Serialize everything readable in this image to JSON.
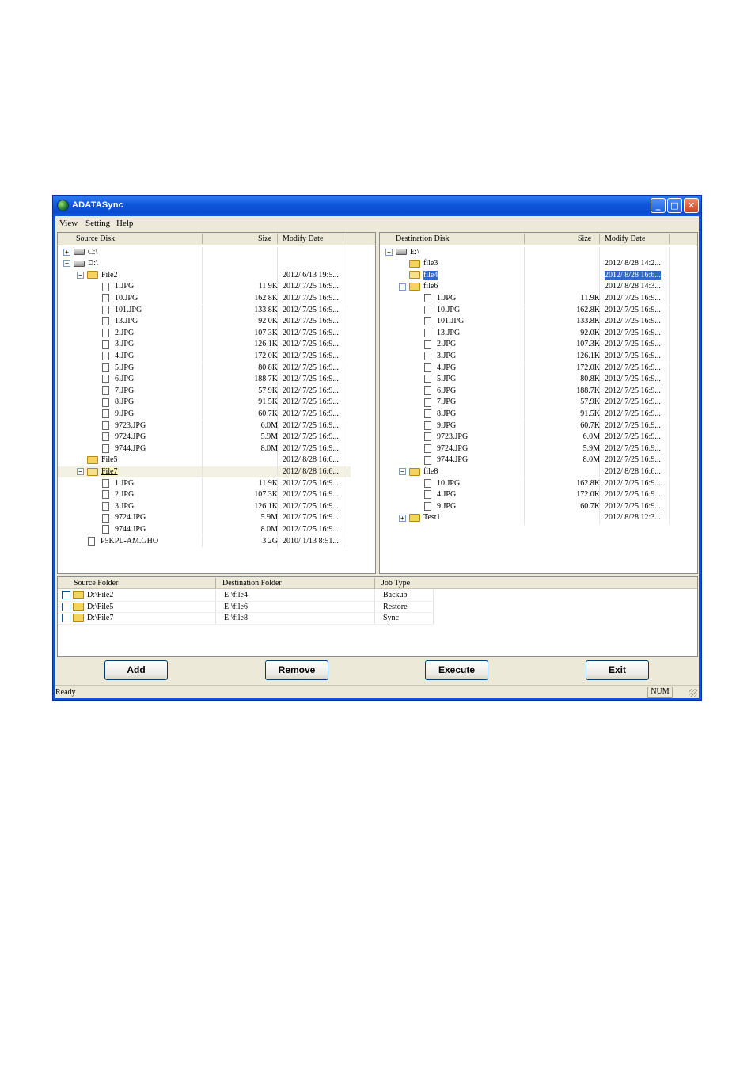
{
  "window": {
    "title": "ADATASync",
    "icons": {
      "app": "globe-sync-icon",
      "minimize": "minimize-icon",
      "maximize": "maximize-icon",
      "close": "close-icon"
    }
  },
  "menu": {
    "items": [
      "View",
      "Setting",
      "Help"
    ]
  },
  "source": {
    "headers": {
      "name": "Source Disk",
      "size": "Size",
      "date": "Modify Date"
    },
    "rows": [
      {
        "level": 0,
        "type": "drive",
        "expander": "+",
        "name": "C:\\",
        "size": "",
        "date": ""
      },
      {
        "level": 0,
        "type": "drive",
        "expander": "-",
        "name": "D:\\",
        "size": "",
        "date": ""
      },
      {
        "level": 1,
        "type": "folder",
        "expander": "-",
        "name": "File2",
        "size": "",
        "date": "2012/ 6/13 19:5..."
      },
      {
        "level": 2,
        "type": "file",
        "name": "1.JPG",
        "size": "11.9K",
        "date": "2012/ 7/25 16:9..."
      },
      {
        "level": 2,
        "type": "file",
        "name": "10.JPG",
        "size": "162.8K",
        "date": "2012/ 7/25 16:9..."
      },
      {
        "level": 2,
        "type": "file",
        "name": "101.JPG",
        "size": "133.8K",
        "date": "2012/ 7/25 16:9..."
      },
      {
        "level": 2,
        "type": "file",
        "name": "13.JPG",
        "size": "92.0K",
        "date": "2012/ 7/25 16:9..."
      },
      {
        "level": 2,
        "type": "file",
        "name": "2.JPG",
        "size": "107.3K",
        "date": "2012/ 7/25 16:9..."
      },
      {
        "level": 2,
        "type": "file",
        "name": "3.JPG",
        "size": "126.1K",
        "date": "2012/ 7/25 16:9..."
      },
      {
        "level": 2,
        "type": "file",
        "name": "4.JPG",
        "size": "172.0K",
        "date": "2012/ 7/25 16:9..."
      },
      {
        "level": 2,
        "type": "file",
        "name": "5.JPG",
        "size": "80.8K",
        "date": "2012/ 7/25 16:9..."
      },
      {
        "level": 2,
        "type": "file",
        "name": "6.JPG",
        "size": "188.7K",
        "date": "2012/ 7/25 16:9..."
      },
      {
        "level": 2,
        "type": "file",
        "name": "7.JPG",
        "size": "57.9K",
        "date": "2012/ 7/25 16:9..."
      },
      {
        "level": 2,
        "type": "file",
        "name": "8.JPG",
        "size": "91.5K",
        "date": "2012/ 7/25 16:9..."
      },
      {
        "level": 2,
        "type": "file",
        "name": "9.JPG",
        "size": "60.7K",
        "date": "2012/ 7/25 16:9..."
      },
      {
        "level": 2,
        "type": "file",
        "name": "9723.JPG",
        "size": "6.0M",
        "date": "2012/ 7/25 16:9..."
      },
      {
        "level": 2,
        "type": "file",
        "name": "9724.JPG",
        "size": "5.9M",
        "date": "2012/ 7/25 16:9..."
      },
      {
        "level": 2,
        "type": "file",
        "name": "9744.JPG",
        "size": "8.0M",
        "date": "2012/ 7/25 16:9..."
      },
      {
        "level": 1,
        "type": "folder",
        "expander": "",
        "name": "File5",
        "size": "",
        "date": "2012/ 8/28 16:6..."
      },
      {
        "level": 1,
        "type": "folder-open",
        "expander": "-",
        "name": "File7",
        "size": "",
        "date": "2012/ 8/28 16:6...",
        "selected": "soft"
      },
      {
        "level": 2,
        "type": "file",
        "name": "1.JPG",
        "size": "11.9K",
        "date": "2012/ 7/25 16:9..."
      },
      {
        "level": 2,
        "type": "file",
        "name": "2.JPG",
        "size": "107.3K",
        "date": "2012/ 7/25 16:9..."
      },
      {
        "level": 2,
        "type": "file",
        "name": "3.JPG",
        "size": "126.1K",
        "date": "2012/ 7/25 16:9..."
      },
      {
        "level": 2,
        "type": "file",
        "name": "9724.JPG",
        "size": "5.9M",
        "date": "2012/ 7/25 16:9..."
      },
      {
        "level": 2,
        "type": "file",
        "name": "9744.JPG",
        "size": "8.0M",
        "date": "2012/ 7/25 16:9..."
      },
      {
        "level": 1,
        "type": "file",
        "name": "P5KPL-AM.GHO",
        "size": "3.2G",
        "date": "2010/ 1/13 8:51..."
      }
    ]
  },
  "destination": {
    "headers": {
      "name": "Destination Disk",
      "size": "Size",
      "date": "Modify Date"
    },
    "rows": [
      {
        "level": 0,
        "type": "drive",
        "expander": "-",
        "name": "E:\\",
        "size": "",
        "date": ""
      },
      {
        "level": 1,
        "type": "folder",
        "expander": "",
        "name": "file3",
        "size": "",
        "date": "2012/ 8/28 14:2..."
      },
      {
        "level": 1,
        "type": "folder-open",
        "expander": "",
        "name": "file4",
        "size": "",
        "date": "2012/ 8/28 16:6...",
        "selected": "blue"
      },
      {
        "level": 1,
        "type": "folder",
        "expander": "-",
        "name": "file6",
        "size": "",
        "date": "2012/ 8/28 14:3..."
      },
      {
        "level": 2,
        "type": "file",
        "name": "1.JPG",
        "size": "11.9K",
        "date": "2012/ 7/25 16:9..."
      },
      {
        "level": 2,
        "type": "file",
        "name": "10.JPG",
        "size": "162.8K",
        "date": "2012/ 7/25 16:9..."
      },
      {
        "level": 2,
        "type": "file",
        "name": "101.JPG",
        "size": "133.8K",
        "date": "2012/ 7/25 16:9..."
      },
      {
        "level": 2,
        "type": "file",
        "name": "13.JPG",
        "size": "92.0K",
        "date": "2012/ 7/25 16:9..."
      },
      {
        "level": 2,
        "type": "file",
        "name": "2.JPG",
        "size": "107.3K",
        "date": "2012/ 7/25 16:9..."
      },
      {
        "level": 2,
        "type": "file",
        "name": "3.JPG",
        "size": "126.1K",
        "date": "2012/ 7/25 16:9..."
      },
      {
        "level": 2,
        "type": "file",
        "name": "4.JPG",
        "size": "172.0K",
        "date": "2012/ 7/25 16:9..."
      },
      {
        "level": 2,
        "type": "file",
        "name": "5.JPG",
        "size": "80.8K",
        "date": "2012/ 7/25 16:9..."
      },
      {
        "level": 2,
        "type": "file",
        "name": "6.JPG",
        "size": "188.7K",
        "date": "2012/ 7/25 16:9..."
      },
      {
        "level": 2,
        "type": "file",
        "name": "7.JPG",
        "size": "57.9K",
        "date": "2012/ 7/25 16:9..."
      },
      {
        "level": 2,
        "type": "file",
        "name": "8.JPG",
        "size": "91.5K",
        "date": "2012/ 7/25 16:9..."
      },
      {
        "level": 2,
        "type": "file",
        "name": "9.JPG",
        "size": "60.7K",
        "date": "2012/ 7/25 16:9..."
      },
      {
        "level": 2,
        "type": "file",
        "name": "9723.JPG",
        "size": "6.0M",
        "date": "2012/ 7/25 16:9..."
      },
      {
        "level": 2,
        "type": "file",
        "name": "9724.JPG",
        "size": "5.9M",
        "date": "2012/ 7/25 16:9..."
      },
      {
        "level": 2,
        "type": "file",
        "name": "9744.JPG",
        "size": "8.0M",
        "date": "2012/ 7/25 16:9..."
      },
      {
        "level": 1,
        "type": "folder",
        "expander": "-",
        "name": "file8",
        "size": "",
        "date": "2012/ 8/28 16:6..."
      },
      {
        "level": 2,
        "type": "file",
        "name": "10.JPG",
        "size": "162.8K",
        "date": "2012/ 7/25 16:9..."
      },
      {
        "level": 2,
        "type": "file",
        "name": "4.JPG",
        "size": "172.0K",
        "date": "2012/ 7/25 16:9..."
      },
      {
        "level": 2,
        "type": "file",
        "name": "9.JPG",
        "size": "60.7K",
        "date": "2012/ 7/25 16:9..."
      },
      {
        "level": 1,
        "type": "folder",
        "expander": "+",
        "name": "Test1",
        "size": "",
        "date": "2012/ 8/28 12:3..."
      }
    ]
  },
  "jobs": {
    "headers": {
      "source": "Source Folder",
      "dest": "Destination Folder",
      "type": "Job Type"
    },
    "rows": [
      {
        "source": "D:\\File2",
        "dest": "E:\\file4",
        "type": "Backup"
      },
      {
        "source": "D:\\File5",
        "dest": "E:\\file6",
        "type": "Restore"
      },
      {
        "source": "D:\\File7",
        "dest": "E:\\file8",
        "type": "Sync"
      }
    ]
  },
  "buttons": {
    "add": "Add",
    "remove": "Remove",
    "execute": "Execute",
    "exit": "Exit"
  },
  "status": {
    "text": "Ready",
    "num": "NUM"
  },
  "colors": {
    "title_blue": "#0a54d8",
    "selection": "#316ac5",
    "window_face": "#ece9d8",
    "folder": "#f4d35e"
  }
}
